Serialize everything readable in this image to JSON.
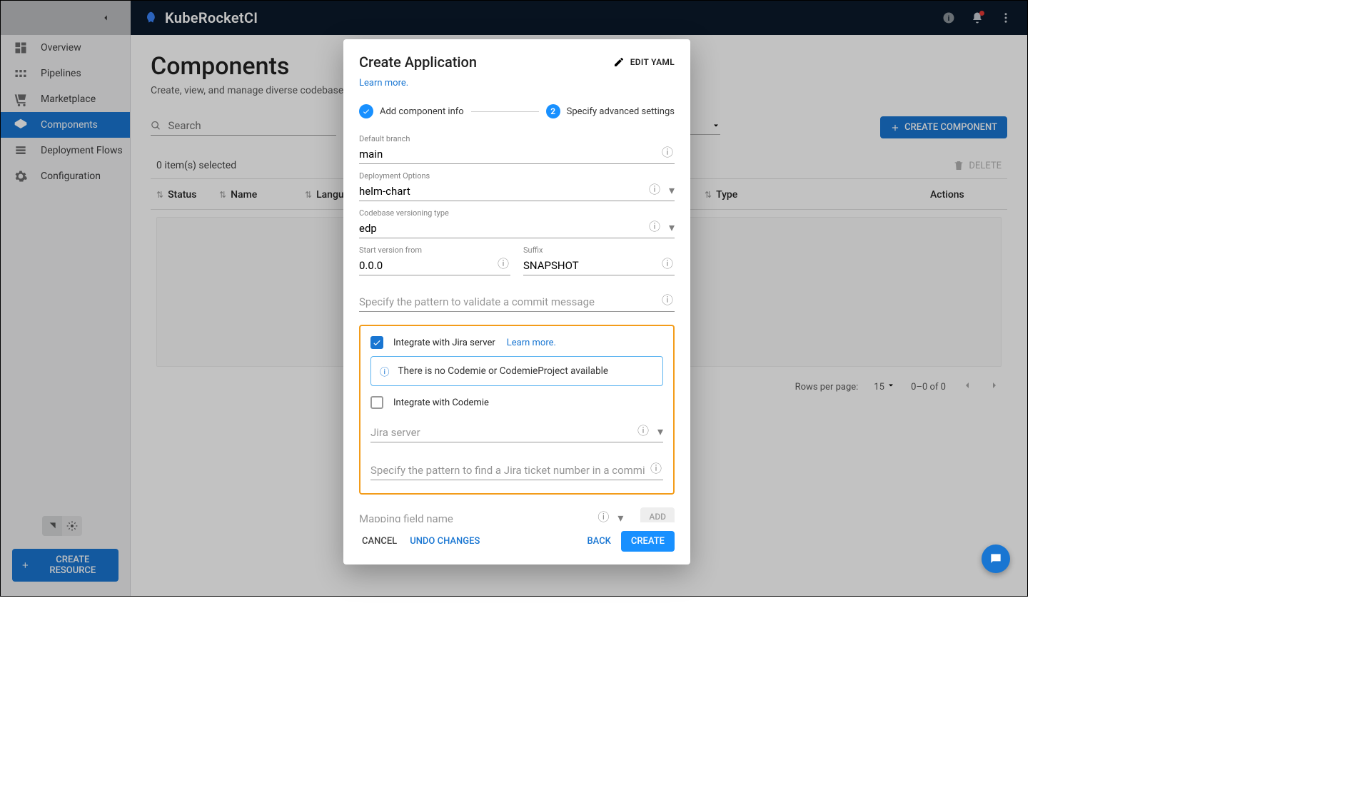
{
  "brand": "KubeRocketCI",
  "sidebar": {
    "items": [
      {
        "label": "Overview"
      },
      {
        "label": "Pipelines"
      },
      {
        "label": "Marketplace"
      },
      {
        "label": "Components"
      },
      {
        "label": "Deployment Flows"
      },
      {
        "label": "Configuration"
      }
    ],
    "create_resource": "CREATE RESOURCE"
  },
  "page": {
    "title": "Components",
    "subtitle": "Create, view, and manage diverse codebases, encompassing applications, libraries, autotests, and infrastructure.",
    "search_placeholder": "Search",
    "create_component": "CREATE COMPONENT",
    "selected_text": "0 item(s) selected",
    "delete_label": "DELETE"
  },
  "table": {
    "headers": {
      "status": "Status",
      "name": "Name",
      "language": "Language",
      "type": "Type",
      "actions": "Actions"
    }
  },
  "pager": {
    "rows_label": "Rows per page:",
    "rows": "15",
    "range": "0–0 of 0"
  },
  "modal": {
    "title": "Create Application",
    "edit_yaml": "EDIT YAML",
    "learn_more": "Learn more.",
    "step1": "Add component info",
    "step2": "Specify advanced settings",
    "fields": {
      "default_branch_label": "Default branch",
      "default_branch_value": "main",
      "deployment_options_label": "Deployment Options",
      "deployment_options_value": "helm-chart",
      "versioning_label": "Codebase versioning type",
      "versioning_value": "edp",
      "start_version_label": "Start version from",
      "start_version_value": "0.0.0",
      "suffix_label": "Suffix",
      "suffix_value": "SNAPSHOT",
      "commit_pattern_placeholder": "Specify the pattern to validate a commit message",
      "jira_checkbox": "Integrate with Jira server",
      "jira_learn": "Learn more.",
      "codemie_banner": "There is no Codemie or CodemieProject available",
      "codemie_checkbox": "Integrate with Codemie",
      "jira_server_placeholder": "Jira server",
      "jira_ticket_placeholder": "Specify the pattern to find a Jira ticket number in a commit message",
      "mapping_placeholder": "Mapping field name",
      "add": "ADD"
    },
    "footer": {
      "cancel": "CANCEL",
      "undo": "UNDO CHANGES",
      "back": "BACK",
      "create": "CREATE"
    }
  }
}
